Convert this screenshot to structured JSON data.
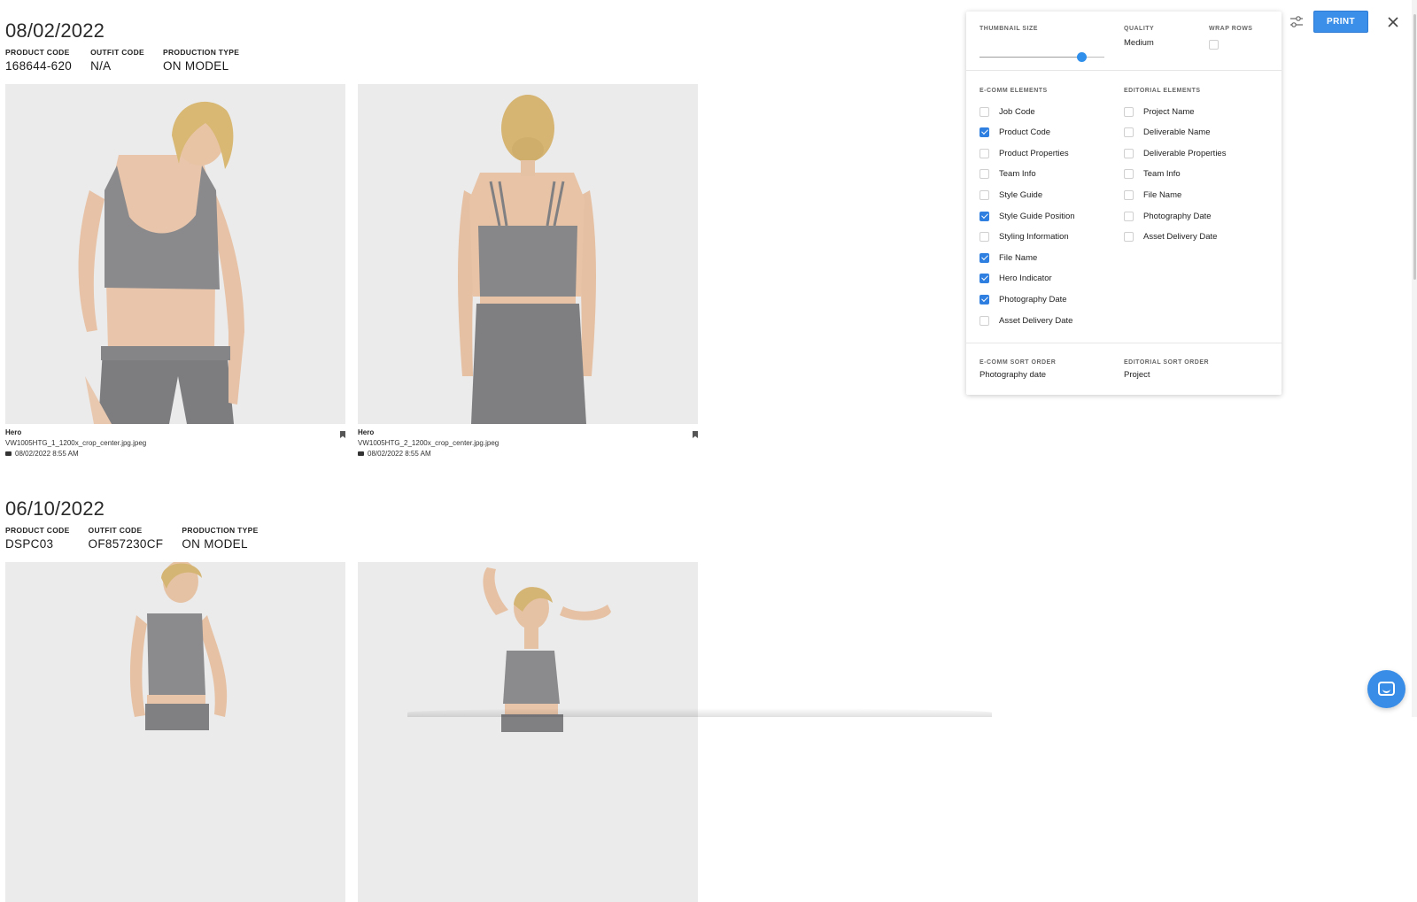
{
  "groups": [
    {
      "date": "08/02/2022",
      "meta": [
        {
          "label": "PRODUCT CODE",
          "value": "168644-620"
        },
        {
          "label": "OUTFIT CODE",
          "value": "N/A"
        },
        {
          "label": "PRODUCTION TYPE",
          "value": "ON MODEL"
        }
      ],
      "photos": [
        {
          "title": "Hero",
          "file": "VW1005HTG_1_1200x_crop_center.jpg.jpeg",
          "date": "08/02/2022 8:55 AM",
          "icon": "bookmark-icon"
        },
        {
          "title": "Hero",
          "file": "VW1005HTG_2_1200x_crop_center.jpg.jpeg",
          "date": "08/02/2022 8:55 AM",
          "icon": "bookmark-icon"
        }
      ]
    },
    {
      "date": "06/10/2022",
      "meta": [
        {
          "label": "PRODUCT CODE",
          "value": "DSPC03"
        },
        {
          "label": "OUTFIT CODE",
          "value": "OF857230CF"
        },
        {
          "label": "PRODUCTION TYPE",
          "value": "ON MODEL"
        }
      ]
    }
  ],
  "toolbar": {
    "print_label": "PRINT",
    "adjust_icon": "sliders-icon",
    "close_icon": "close-icon"
  },
  "panel": {
    "thumbnail_size_label": "THUMBNAIL SIZE",
    "thumbnail_size_fraction": 0.82,
    "quality_label": "QUALITY",
    "quality_value": "Medium",
    "wrap_rows_label": "WRAP ROWS",
    "wrap_rows_checked": false,
    "ecomm_title": "E-COMM ELEMENTS",
    "editorial_title": "EDITORIAL ELEMENTS",
    "ecomm_items": [
      {
        "label": "Job Code",
        "checked": false
      },
      {
        "label": "Product Code",
        "checked": true
      },
      {
        "label": "Product Properties",
        "checked": false
      },
      {
        "label": "Team Info",
        "checked": false
      },
      {
        "label": "Style Guide",
        "checked": false
      },
      {
        "label": "Style Guide Position",
        "checked": true
      },
      {
        "label": "Styling Information",
        "checked": false
      },
      {
        "label": "File Name",
        "checked": true
      },
      {
        "label": "Hero Indicator",
        "checked": true
      },
      {
        "label": "Photography Date",
        "checked": true
      },
      {
        "label": "Asset Delivery Date",
        "checked": false
      }
    ],
    "editorial_items": [
      {
        "label": "Project Name",
        "checked": false
      },
      {
        "label": "Deliverable Name",
        "checked": false
      },
      {
        "label": "Deliverable Properties",
        "checked": false
      },
      {
        "label": "Team Info",
        "checked": false
      },
      {
        "label": "File Name",
        "checked": false
      },
      {
        "label": "Photography Date",
        "checked": false
      },
      {
        "label": "Asset Delivery Date",
        "checked": false
      }
    ],
    "ecomm_sort_label": "E-COMM SORT ORDER",
    "ecomm_sort_value": "Photography date",
    "editorial_sort_label": "EDITORIAL SORT ORDER",
    "editorial_sort_value": "Project"
  },
  "colors": {
    "accent": "#3b8fe8",
    "checkbox_checked": "#2f7fe0",
    "chat_button": "#3a8de6"
  },
  "chat_icon": "chat-icon"
}
